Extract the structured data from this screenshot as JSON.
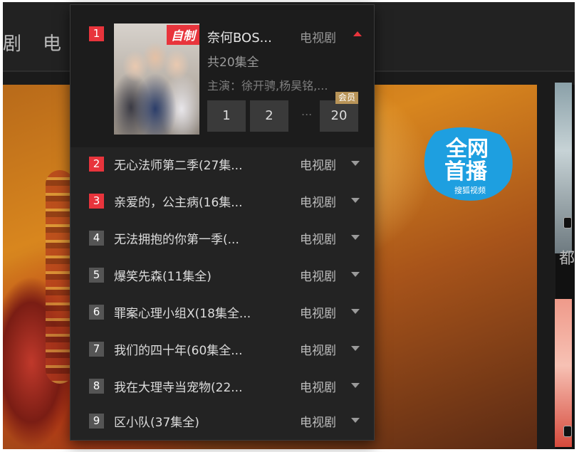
{
  "nav": {
    "item_1": "剧",
    "item_2": "电"
  },
  "badge": {
    "line1": "全网",
    "line2": "首播",
    "brand": "搜狐视频"
  },
  "side": {
    "label": "都"
  },
  "panel": {
    "top_item": {
      "rank": "1",
      "tag": "自制",
      "title": "奈何BOS...",
      "category": "电视剧",
      "episodes": "共20集全",
      "cast": "主演：徐开骋,杨昊铭,...",
      "episode_buttons": [
        "1",
        "2",
        "20"
      ],
      "ellipsis": "...",
      "vip_label": "会员"
    },
    "items": [
      {
        "rank": "2",
        "title": "无心法师第二季(27集...",
        "category": "电视剧",
        "hot": true
      },
      {
        "rank": "3",
        "title": "亲爱的，公主病(16集...",
        "category": "电视剧",
        "hot": true
      },
      {
        "rank": "4",
        "title": "无法拥抱的你第一季(...",
        "category": "电视剧",
        "hot": false
      },
      {
        "rank": "5",
        "title": "爆笑先森(11集全)",
        "category": "电视剧",
        "hot": false
      },
      {
        "rank": "6",
        "title": "罪案心理小组X(18集全...",
        "category": "电视剧",
        "hot": false
      },
      {
        "rank": "7",
        "title": "我们的四十年(60集全...",
        "category": "电视剧",
        "hot": false
      },
      {
        "rank": "8",
        "title": "我在大理寺当宠物(22...",
        "category": "电视剧",
        "hot": false
      },
      {
        "rank": "9",
        "title": "区小队(37集全)",
        "category": "电视剧",
        "hot": false
      }
    ]
  },
  "colors": {
    "hot_rank": "#e8343c",
    "normal_rank": "#555555",
    "vip": "#b89458"
  }
}
